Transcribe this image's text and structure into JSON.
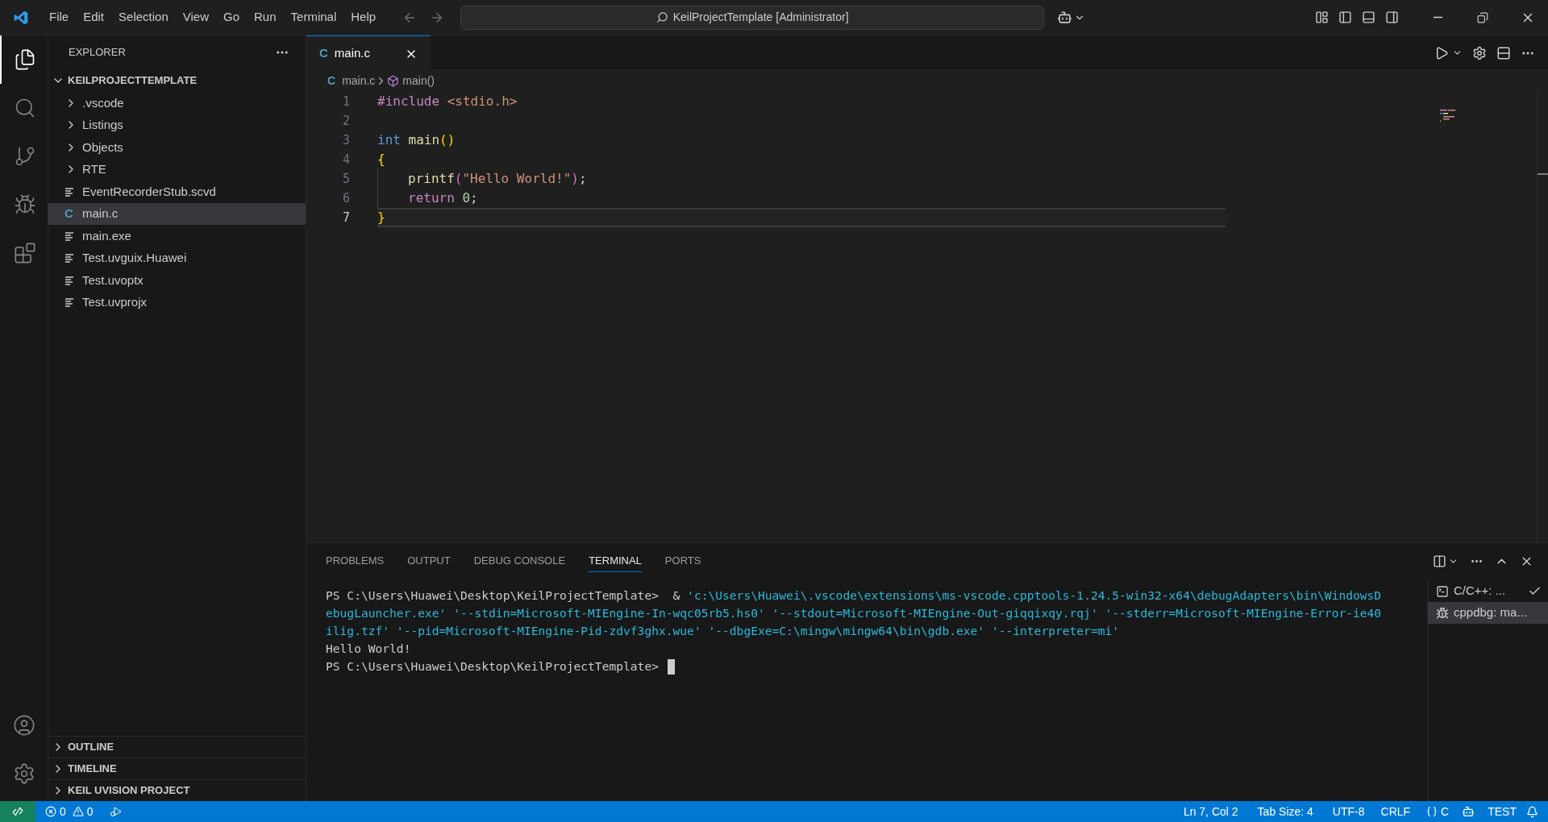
{
  "title_bar": {
    "menu": [
      "File",
      "Edit",
      "Selection",
      "View",
      "Go",
      "Run",
      "Terminal",
      "Help"
    ],
    "command_center": "KeilProjectTemplate [Administrator]"
  },
  "activity_bar": {
    "items": [
      {
        "kind": "explorer",
        "selected": true
      },
      {
        "kind": "search",
        "selected": false
      },
      {
        "kind": "source-control",
        "selected": false
      },
      {
        "kind": "run-debug",
        "selected": false
      },
      {
        "kind": "extensions",
        "selected": false
      }
    ]
  },
  "sidebar": {
    "title": "EXPLORER",
    "root": {
      "label": "KEILPROJECTTEMPLATE",
      "expanded": true,
      "children": [
        {
          "label": ".vscode",
          "kind": "folder",
          "expanded": false,
          "selected": false
        },
        {
          "label": "Listings",
          "kind": "folder",
          "expanded": false,
          "selected": false
        },
        {
          "label": "Objects",
          "kind": "folder",
          "expanded": false,
          "selected": false
        },
        {
          "label": "RTE",
          "kind": "folder",
          "expanded": false,
          "selected": false
        },
        {
          "label": "EventRecorderStub.scvd",
          "kind": "file",
          "selected": false
        },
        {
          "label": "main.c",
          "kind": "c-file",
          "icon": "C",
          "selected": true
        },
        {
          "label": "main.exe",
          "kind": "file",
          "selected": false
        },
        {
          "label": "Test.uvguix.Huawei",
          "kind": "file",
          "selected": false
        },
        {
          "label": "Test.uvoptx",
          "kind": "file",
          "selected": false
        },
        {
          "label": "Test.uvprojx",
          "kind": "file",
          "selected": false
        }
      ]
    },
    "sections": [
      {
        "label": "OUTLINE",
        "expanded": false
      },
      {
        "label": "TIMELINE",
        "expanded": false
      },
      {
        "label": "KEIL UVISION PROJECT",
        "expanded": false
      }
    ]
  },
  "editor": {
    "tabs": [
      {
        "label": "main.c",
        "icon": "C",
        "selected": true
      }
    ],
    "breadcrumb": [
      {
        "label": "main.c",
        "icon": "C"
      },
      {
        "label": "main()"
      }
    ],
    "lines": [
      {
        "number": "1",
        "current": false,
        "tokens": [
          {
            "text": "#include",
            "kind": "directive"
          },
          {
            "text": " <stdio.h>",
            "kind": "string"
          }
        ]
      },
      {
        "number": "2",
        "current": false
      },
      {
        "number": "3",
        "current": false,
        "tokens": [
          {
            "text": "int",
            "kind": "keyword"
          },
          {
            "text": " main",
            "kind": "function"
          },
          {
            "text": "()",
            "kind": "bracket"
          }
        ]
      },
      {
        "number": "4",
        "current": false,
        "tokens": [
          {
            "text": "{",
            "kind": "bracket"
          }
        ]
      },
      {
        "number": "5",
        "current": false,
        "indented": true,
        "tokens": [
          {
            "text": "printf",
            "kind": "function"
          },
          {
            "text": "(",
            "kind": "bracket2"
          },
          {
            "text": "\"Hello World!\"",
            "kind": "string"
          },
          {
            "text": ")",
            "kind": "bracket2"
          },
          {
            "text": ";",
            "kind": "plain"
          }
        ]
      },
      {
        "number": "6",
        "current": false,
        "indented": true,
        "tokens": [
          {
            "text": "return",
            "kind": "directive"
          },
          {
            "text": " 0",
            "kind": "number"
          },
          {
            "text": ";",
            "kind": "plain"
          }
        ]
      },
      {
        "number": "7",
        "current": true,
        "tokens": [
          {
            "text": "}",
            "kind": "bracket"
          }
        ]
      }
    ]
  },
  "panel": {
    "tabs": [
      {
        "label": "PROBLEMS",
        "selected": false
      },
      {
        "label": "OUTPUT",
        "selected": false
      },
      {
        "label": "DEBUG CONSOLE",
        "selected": false
      },
      {
        "label": "TERMINAL",
        "selected": true
      },
      {
        "label": "PORTS",
        "selected": false
      }
    ],
    "terminal_lines": [
      [
        {
          "text": "PS C:\\Users\\Huawei\\Desktop\\KeilProjectTemplate>  & ",
          "kind": "plain"
        },
        {
          "text": "'c:\\Users\\Huawei\\.vscode\\extensions\\ms-vscode.cpptools-1.24.5-win32-x64\\debugAdapters\\bin\\WindowsD",
          "kind": "arg"
        }
      ],
      [
        {
          "text": "ebugLauncher.exe' '--stdin=Microsoft-MIEngine-In-wqc05rb5.hs0' '--stdout=Microsoft-MIEngine-Out-giqqixqy.rqj' '--stderr=Microsoft-MIEngine-Error-ie40",
          "kind": "arg"
        }
      ],
      [
        {
          "text": "ilig.tzf' '--pid=Microsoft-MIEngine-Pid-zdvf3ghx.wue' '--dbgExe=C:\\mingw\\mingw64\\bin\\gdb.exe' '--interpreter=mi'",
          "kind": "arg"
        }
      ],
      [
        {
          "text": "Hello World!",
          "kind": "plain"
        }
      ],
      [
        {
          "text": "PS C:\\Users\\Huawei\\Desktop\\KeilProjectTemplate> ",
          "kind": "plain"
        }
      ]
    ],
    "cursor": true,
    "terminals": [
      {
        "label": "C/C++: ...",
        "kind": "task",
        "checked": true,
        "selected": false
      },
      {
        "label": "cppdbg: ma...",
        "kind": "debug",
        "selected": true
      }
    ]
  },
  "status_bar": {
    "errors": "0",
    "warnings": "0",
    "right": [
      "Ln 7, Col 2",
      "Tab Size: 4",
      "UTF-8",
      "CRLF",
      "C",
      "TEST"
    ]
  }
}
